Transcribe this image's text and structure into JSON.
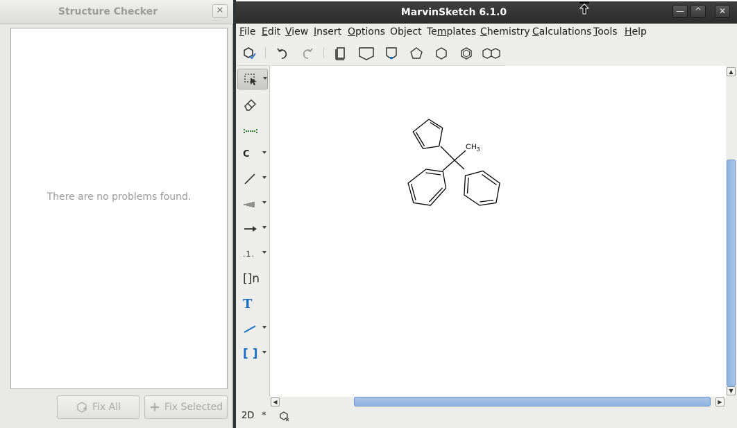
{
  "structure_checker": {
    "title": "Structure Checker",
    "close_glyph": "✕",
    "empty_message": "There are no problems found.",
    "fix_all_label": "Fix All",
    "fix_selected_label": "Fix Selected"
  },
  "marvin": {
    "title": "MarvinSketch 6.1.0",
    "window_buttons": {
      "minimize": "—",
      "maximize": "^",
      "close": "✕"
    },
    "menu": [
      {
        "pre": "",
        "u": "F",
        "post": "ile"
      },
      {
        "pre": "",
        "u": "E",
        "post": "dit"
      },
      {
        "pre": "",
        "u": "V",
        "post": "iew"
      },
      {
        "pre": "",
        "u": "I",
        "post": "nsert"
      },
      {
        "pre": "",
        "u": "O",
        "post": "ptions"
      },
      {
        "pre": "Object",
        "u": "",
        "post": ""
      },
      {
        "pre": "Te",
        "u": "m",
        "post": "plates"
      },
      {
        "pre": "",
        "u": "C",
        "post": "hemistry"
      },
      {
        "pre": "",
        "u": "C",
        "post": "alculations"
      },
      {
        "pre": "",
        "u": "T",
        "post": "ools"
      },
      {
        "pre": "",
        "u": "H",
        "post": "elp"
      }
    ],
    "toolbar_icons": [
      "structure-check-icon",
      "undo-icon",
      "redo-icon",
      "template-library-icon",
      "template-shape-icon",
      "template-bracket-icon",
      "pentagon-icon",
      "hexagon-icon",
      "benzene-icon",
      "naphthalene-icon"
    ],
    "left_tools": [
      {
        "name": "select-tool",
        "label": ""
      },
      {
        "name": "erase-tool",
        "label": ""
      },
      {
        "name": "atom-map-tool",
        "label": ""
      },
      {
        "name": "atom-tool",
        "label": "C"
      },
      {
        "name": "bond-tool",
        "label": ""
      },
      {
        "name": "chain-tool",
        "label": ""
      },
      {
        "name": "reaction-arrow-tool",
        "label": ""
      },
      {
        "name": "charge-tool",
        "label": ".1."
      },
      {
        "name": "bracket-n-tool",
        "label": "[]n"
      },
      {
        "name": "text-tool",
        "label": "T"
      },
      {
        "name": "line-tool",
        "label": ""
      },
      {
        "name": "bracket-tool",
        "label": "[ ]"
      }
    ],
    "molecule": {
      "substituent_label": "CH",
      "substituent_subscript": "3"
    },
    "status": {
      "mode": "2D",
      "modified": "*"
    },
    "colors": {
      "accent_blue": "#1a6fc4",
      "scroll_thumb": "#9bbce6"
    }
  }
}
